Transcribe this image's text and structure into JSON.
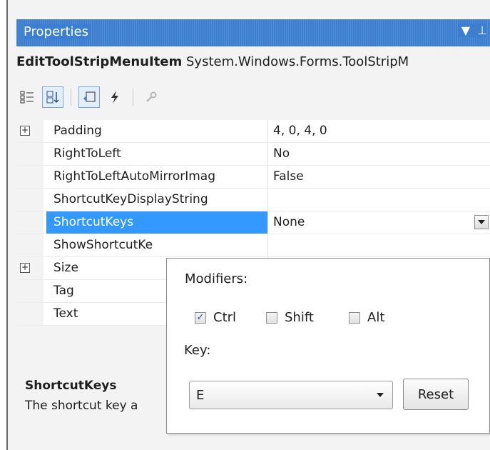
{
  "panel": {
    "title": "Properties",
    "object_name": "EditToolStripMenuItem",
    "object_type": "System.Windows.Forms.ToolStripM"
  },
  "toolbar": {
    "buttons": [
      {
        "icon": "categorized-icon"
      },
      {
        "icon": "alphabetical-icon"
      },
      {
        "icon": "properties-icon"
      },
      {
        "icon": "events-icon"
      },
      {
        "icon": "property-pages-icon"
      }
    ]
  },
  "properties": [
    {
      "name": "Padding",
      "value": "4, 0, 4, 0",
      "expandable": true
    },
    {
      "name": "RightToLeft",
      "value": "No",
      "expandable": false
    },
    {
      "name": "RightToLeftAutoMirrorImag",
      "value": "False",
      "expandable": false
    },
    {
      "name": "ShortcutKeyDisplayString",
      "value": "",
      "expandable": false
    },
    {
      "name": "ShortcutKeys",
      "value": "None",
      "expandable": false,
      "selected": true
    },
    {
      "name": "ShowShortcutKe",
      "value": "",
      "expandable": false
    },
    {
      "name": "Size",
      "value": "",
      "expandable": true
    },
    {
      "name": "Tag",
      "value": "",
      "expandable": false
    },
    {
      "name": "Text",
      "value": "",
      "expandable": false
    }
  ],
  "description": {
    "title": "ShortcutKeys",
    "text": "The shortcut key a"
  },
  "editor": {
    "modifiers_label": "Modifiers:",
    "ctrl_label": "Ctrl",
    "ctrl_checked": true,
    "shift_label": "Shift",
    "shift_checked": false,
    "alt_label": "Alt",
    "alt_checked": false,
    "key_label": "Key:",
    "key_value": "E",
    "reset_label": "Reset"
  },
  "colors": {
    "title_bar": "#3c7fd0",
    "selection": "#3399ff"
  }
}
